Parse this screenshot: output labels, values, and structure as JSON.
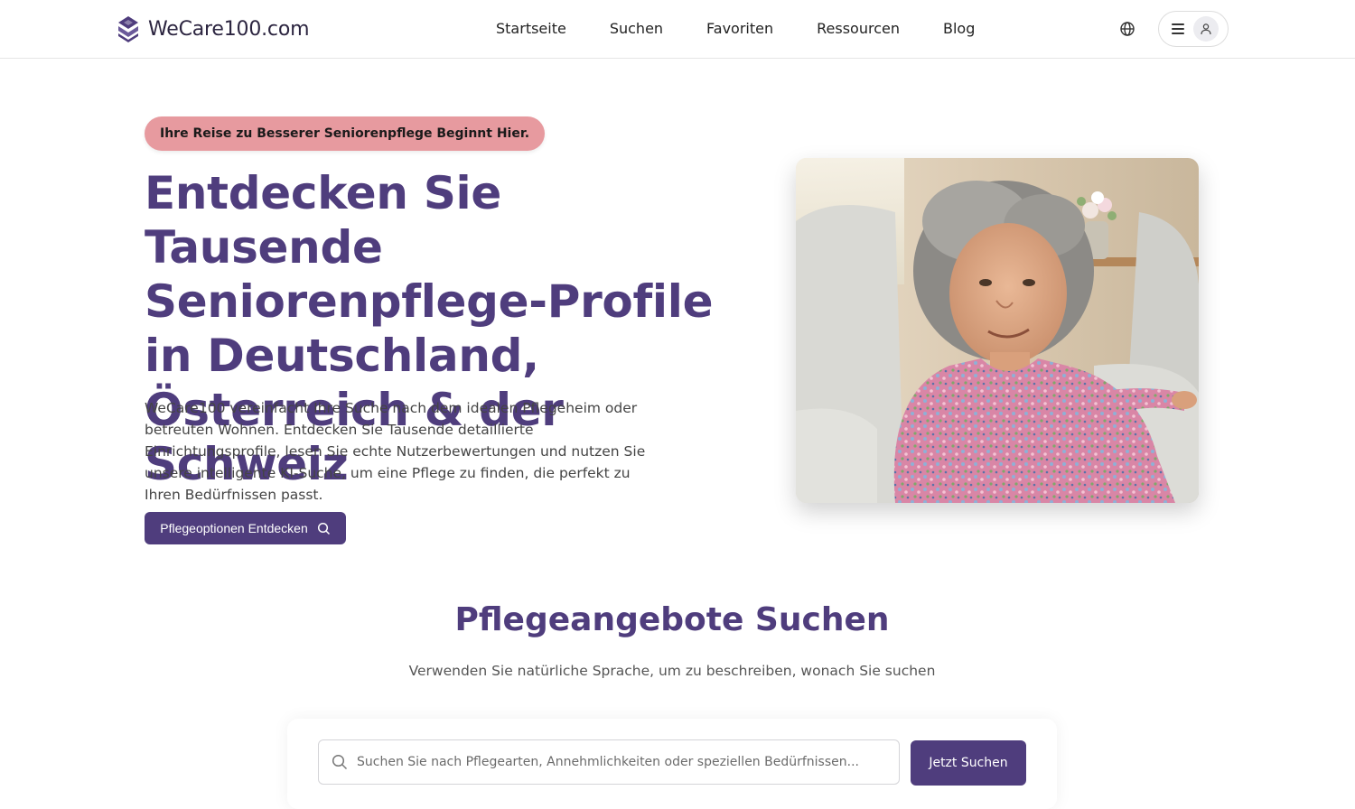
{
  "brand": {
    "name": "WeCare100.com",
    "accent": "#4f3d7d",
    "badge_color": "#e79a9f"
  },
  "nav": {
    "items": [
      {
        "label": "Startseite"
      },
      {
        "label": "Suchen"
      },
      {
        "label": "Favoriten"
      },
      {
        "label": "Ressourcen"
      },
      {
        "label": "Blog"
      }
    ],
    "language_icon": "globe-icon",
    "menu_icon": "menu-icon",
    "avatar_icon": "user-icon"
  },
  "hero": {
    "badge": "Ihre Reise zu Besserer Seniorenpflege Beginnt Hier.",
    "title": "Entdecken Sie Tausende Seniorenpflege-Profile in Deutschland, Österreich & der Schweiz",
    "description": "WeCare100 vereinfacht Ihre Suche nach dem idealen Pflegeheim oder betreuten Wohnen. Entdecken Sie Tausende detaillierte Einrichtungsprofile, lesen Sie echte Nutzerbewertungen und nutzen Sie unsere intelligente KI-Suche, um eine Pflege zu finden, die perfekt zu Ihren Bedürfnissen passt.",
    "cta_label": "Pflegeoptionen Entdecken"
  },
  "search_section": {
    "title": "Pflegeangebote Suchen",
    "subtitle": "Verwenden Sie natürliche Sprache, um zu beschreiben, wonach Sie suchen",
    "placeholder": "Suchen Sie nach Pflegearten, Annehmlichkeiten oder speziellen Bedürfnissen...",
    "button_label": "Jetzt Suchen"
  }
}
